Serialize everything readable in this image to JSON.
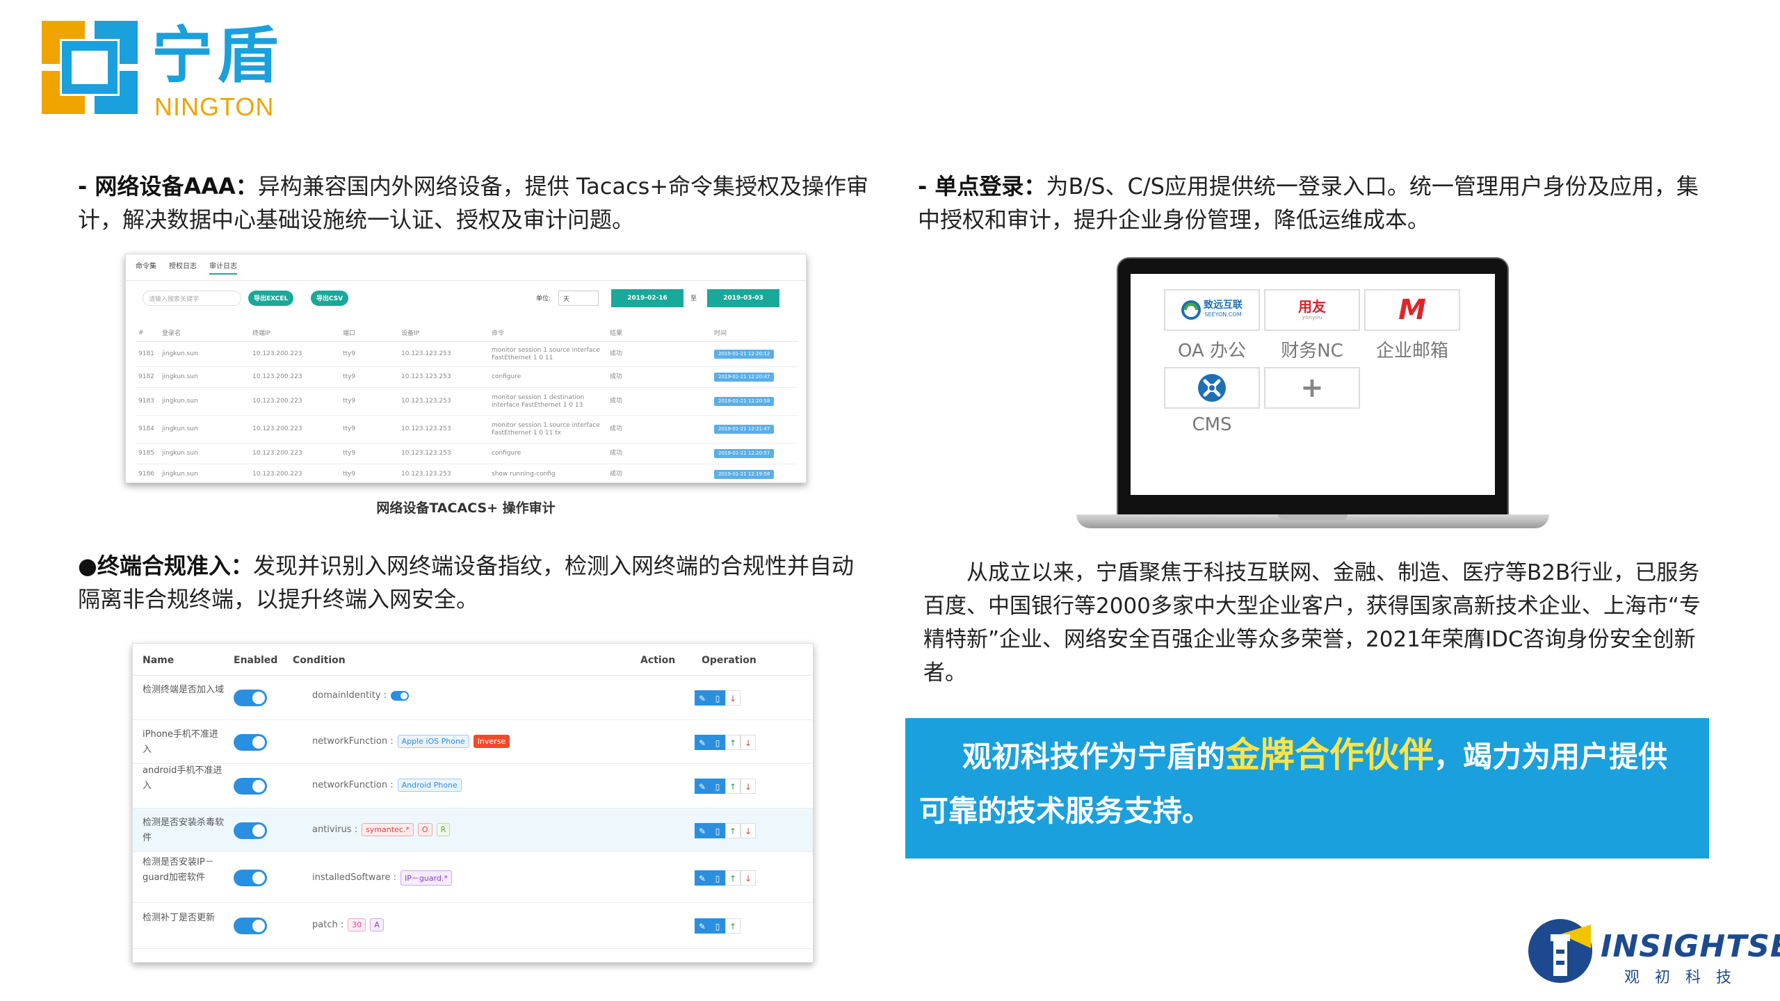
{
  "logo": {
    "cn": "宁盾",
    "en": "NINGTON"
  },
  "aaa": {
    "title": "- 网络设备AAA：",
    "body": "异构兼容国内外网络设备，提供 Tacacs+命令集授权及操作审计，解决数据中心基础设施统一认证、授权及审计问题。",
    "caption": "网络设备TACACS+ 操作审计",
    "shot": {
      "tabs": [
        "命令集",
        "授权日志",
        "审计日志"
      ],
      "search_placeholder": "请输入搜索关键字",
      "btn_excel": "导出EXCEL",
      "btn_csv": "导出CSV",
      "unit_label": "单位:",
      "unit_value": "天",
      "date_from": "2019-02-16",
      "date_to_label": "至",
      "date_to": "2019-03-03",
      "columns": [
        "#",
        "登录名",
        "终端IP",
        "端口",
        "设备IP",
        "命令",
        "结果",
        "时间"
      ],
      "rows": [
        [
          "9181",
          "jingkun.sun",
          "10.123.200.223",
          "tty9",
          "10.123.123.253",
          "monitor session 1 source interface FastEthernet 1 0 11",
          "成功",
          "2019-01-21 12:20:12"
        ],
        [
          "9182",
          "jingkun.sun",
          "10.123.200.223",
          "tty9",
          "10.123.123.253",
          "configure",
          "成功",
          "2019-01-21 12:20:47"
        ],
        [
          "9183",
          "jingkun.sun",
          "10.123.200.223",
          "tty9",
          "10.123.123.253",
          "monitor session 1 destination interface FastEthernet 1 0 13",
          "成功",
          "2019-01-21 12:20:58"
        ],
        [
          "9184",
          "jingkun.sun",
          "10.123.200.223",
          "tty9",
          "10.123.123.253",
          "monitor session 1 source interface FastEthernet 1 0 11 tx",
          "成功",
          "2019-01-21 12:21:47"
        ],
        [
          "9185",
          "jingkun.sun",
          "10.123.200.223",
          "tty9",
          "10.123.123.253",
          "configure",
          "成功",
          "2019-01-21 12:20:57"
        ],
        [
          "9186",
          "jingkun.sun",
          "10.123.200.223",
          "tty9",
          "10.123.123.253",
          "show running-config",
          "成功",
          "2019-01-21 12:19:58"
        ]
      ]
    }
  },
  "nac": {
    "title": "●终端合规准入：",
    "body": "发现并识别入网终端设备指纹，检测入网终端的合规性并自动隔离非合规终端，以提升终端入网安全。",
    "columns": {
      "name": "Name",
      "enabled": "Enabled",
      "condition": "Condition",
      "action": "Action",
      "operation": "Operation"
    },
    "rows": [
      {
        "name": "检测终端是否加入域",
        "cond_key": "domainIdentity :",
        "tags": []
      },
      {
        "name": "iPhone手机不准进入",
        "cond_key": "networkFunction :",
        "tags": [
          {
            "t": "Apple iOS Phone",
            "c": "blue"
          },
          {
            "t": "Inverse",
            "c": "red-solid"
          }
        ]
      },
      {
        "name": "android手机不准进入",
        "cond_key": "networkFunction :",
        "tags": [
          {
            "t": "Android Phone",
            "c": "blue"
          }
        ]
      },
      {
        "name": "检测是否安装杀毒软件",
        "cond_key": "antivirus :",
        "tags": [
          {
            "t": "symantec.*",
            "c": "red"
          },
          {
            "t": "O",
            "c": "red"
          },
          {
            "t": "R",
            "c": "green"
          }
        ]
      },
      {
        "name": "检测是否安装IP－guard加密软件",
        "cond_key": "installedSoftware :",
        "tags": [
          {
            "t": "IP－guard.*",
            "c": "purple"
          }
        ]
      },
      {
        "name": "检测补丁是否更新",
        "cond_key": "patch :",
        "tags": [
          {
            "t": "30",
            "c": "pink"
          },
          {
            "t": "A",
            "c": "purple"
          }
        ]
      }
    ]
  },
  "sso": {
    "title": "- 单点登录：",
    "body": "为B/S、C/S应用提供统一登录入口。统一管理用户身份及应用，集中授权和审计，提升企业身份管理，降低运维成本。",
    "apps": [
      {
        "logo": "致远互联",
        "logo_sub": "SEEYON.COM",
        "label": "OA 办公"
      },
      {
        "logo": "用友",
        "logo_sub": "yonyou",
        "label": "财务NC"
      },
      {
        "logo": "M",
        "label": "企业邮箱"
      },
      {
        "logo": "CMS",
        "label": "CMS"
      },
      {
        "logo": "+",
        "label": ""
      }
    ]
  },
  "company": "从成立以来，宁盾聚焦于科技互联网、金融、制造、医疗等B2B行业，已服务百度、中国银行等2000多家中大型企业客户，获得国家高新技术企业、上海市“专精特新”企业、网络安全百强企业等众多荣誉，2021年荣膺IDC咨询身份安全创新者。",
  "partner": {
    "pre": "观初科技作为宁盾的",
    "highlight": "金牌合作伙伴",
    "post": "，竭力为用户提供可靠的技术服务支持。"
  },
  "footer_logo": {
    "word": "INSIGHTSEC",
    "sub": "观初科技"
  },
  "colors": {
    "brand_blue": "#1aa0dc",
    "brand_orange": "#f0a400",
    "gold": "#ffe34a",
    "table_teal": "#1aa89a"
  }
}
